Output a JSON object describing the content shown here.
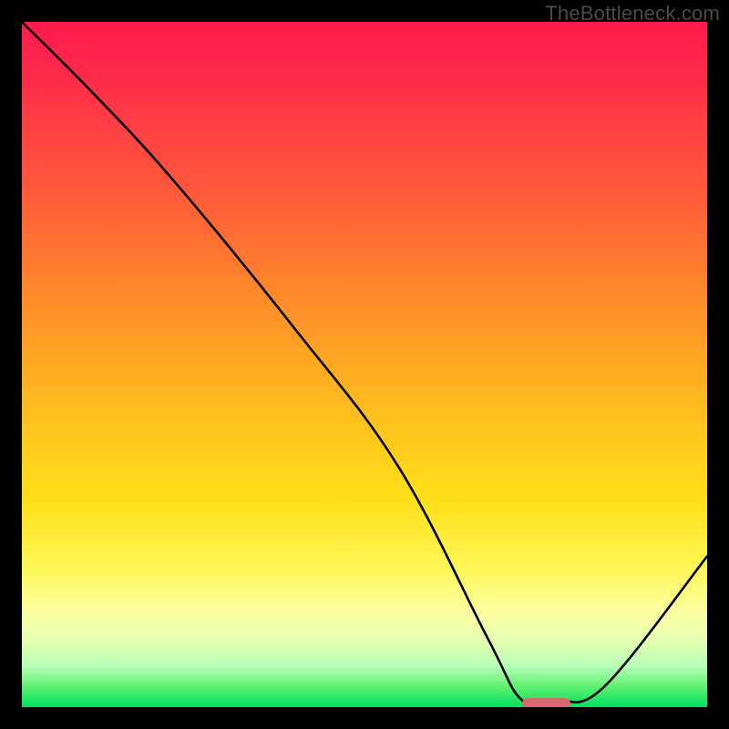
{
  "watermark": "TheBottleneck.com",
  "chart_data": {
    "type": "line",
    "title": "",
    "xlabel": "",
    "ylabel": "",
    "xlim": [
      0,
      100
    ],
    "ylim": [
      0,
      100
    ],
    "grid": false,
    "series": [
      {
        "name": "bottleneck-curve",
        "x": [
          0,
          10,
          22,
          40,
          55,
          68,
          73,
          78,
          85,
          100
        ],
        "y": [
          100,
          90,
          77,
          55,
          35,
          10,
          1,
          1,
          3,
          22
        ]
      }
    ],
    "marker": {
      "name": "optimal-range",
      "x_start": 73,
      "x_end": 80,
      "y": 0.5
    },
    "background_gradient": {
      "stops": [
        {
          "pos": 0.0,
          "color": "#ff1a4d"
        },
        {
          "pos": 0.25,
          "color": "#ff5a3a"
        },
        {
          "pos": 0.55,
          "color": "#ffb820"
        },
        {
          "pos": 0.8,
          "color": "#fff85a"
        },
        {
          "pos": 0.94,
          "color": "#b8ffb8"
        },
        {
          "pos": 1.0,
          "color": "#00e060"
        }
      ]
    }
  }
}
